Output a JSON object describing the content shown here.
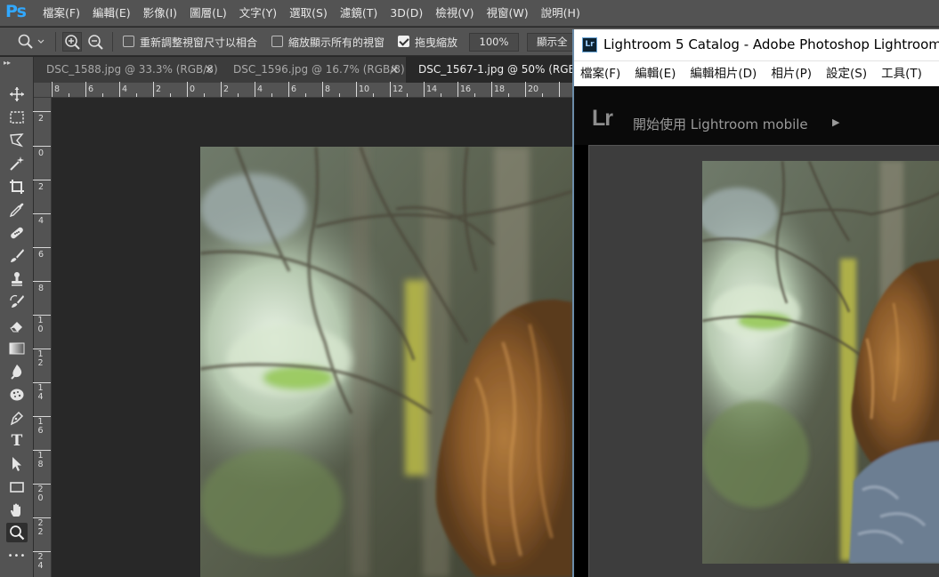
{
  "photoshop": {
    "logo": "Ps",
    "menus": [
      "檔案(F)",
      "編輯(E)",
      "影像(I)",
      "圖層(L)",
      "文字(Y)",
      "選取(S)",
      "濾鏡(T)",
      "3D(D)",
      "檢視(V)",
      "視窗(W)",
      "說明(H)"
    ],
    "options": {
      "resize_windows_label": "重新調整視窗尺寸以相合",
      "resize_windows_checked": false,
      "zoom_all_label": "縮放顯示所有的視窗",
      "zoom_all_checked": false,
      "scrubby_zoom_label": "拖曳縮放",
      "scrubby_zoom_checked": true,
      "zoom_value": "100%",
      "fit_screen_label": "顯示全"
    },
    "tabs": [
      {
        "label": "DSC_1588.jpg @ 33.3% (RGB/8)",
        "close": "×",
        "active": false
      },
      {
        "label": "DSC_1596.jpg @ 16.7% (RGB/8)",
        "close": "×",
        "active": false
      },
      {
        "label": "DSC_1567-1.jpg @ 50% (RGB/8)",
        "close": "×",
        "active": true
      }
    ],
    "ruler_h": [
      "8",
      "6",
      "4",
      "2",
      "0",
      "2",
      "4",
      "6",
      "8",
      "10",
      "12",
      "14",
      "16",
      "18",
      "20"
    ],
    "ruler_v": [
      "2",
      "0",
      "2",
      "4",
      "6",
      "8",
      "10",
      "12",
      "14",
      "16",
      "18",
      "20",
      "22",
      "24"
    ],
    "tools": [
      "move-tool",
      "marquee-tool",
      "lasso-tool",
      "magic-wand-tool",
      "crop-tool",
      "eyedropper-tool",
      "healing-brush-tool",
      "brush-tool",
      "clone-stamp-tool",
      "history-brush-tool",
      "eraser-tool",
      "gradient-tool",
      "blur-tool",
      "sponge-tool",
      "pen-tool",
      "type-tool",
      "path-selection-tool",
      "rectangle-tool",
      "hand-tool",
      "zoom-tool",
      "more-tools"
    ],
    "tool_type_glyph": "T",
    "tool_more_glyph": "•••",
    "selected_tool": "zoom-tool"
  },
  "lightroom": {
    "window_title": "Lightroom 5 Catalog - Adobe Photoshop Lightroom -",
    "icon": "Lr",
    "menus": [
      "檔案(F)",
      "編輯(E)",
      "編輯相片(D)",
      "相片(P)",
      "設定(S)",
      "工具(T)"
    ],
    "logo": "Lr",
    "mobile_prompt": "開始使用 Lightroom mobile",
    "mobile_arrow": "▶"
  },
  "colors": {
    "ps_chrome": "#535353",
    "ps_canvas": "#282828",
    "ps_accent": "#31a8ff",
    "lr_background": "#000000",
    "lr_loupe_bg": "#3d3d3d"
  }
}
